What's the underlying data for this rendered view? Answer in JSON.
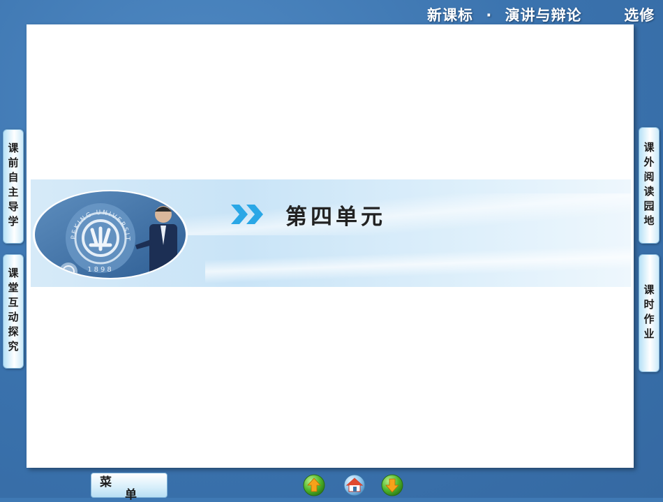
{
  "header": {
    "course": "新课标",
    "separator": "·",
    "subject": "演讲与辩论",
    "type": "选修"
  },
  "banner": {
    "unit_title": "第四单元",
    "photo_text": "PEKING UNIVERSITY",
    "photo_year": "1898",
    "arrows_icon": "double-chevron-right-icon"
  },
  "side_tabs": {
    "left": [
      "课前自主导学",
      "课堂互动探究"
    ],
    "right": [
      "课外阅读园地",
      "课时作业"
    ]
  },
  "bottom_nav": {
    "menu_char1": "菜",
    "menu_char2": "单",
    "icons": [
      "prev-arrow-icon",
      "home-icon",
      "next-arrow-icon"
    ]
  },
  "colors": {
    "background": "#3f79b4",
    "accent": "#2aa7e6",
    "banner": "#d6eaf8"
  }
}
